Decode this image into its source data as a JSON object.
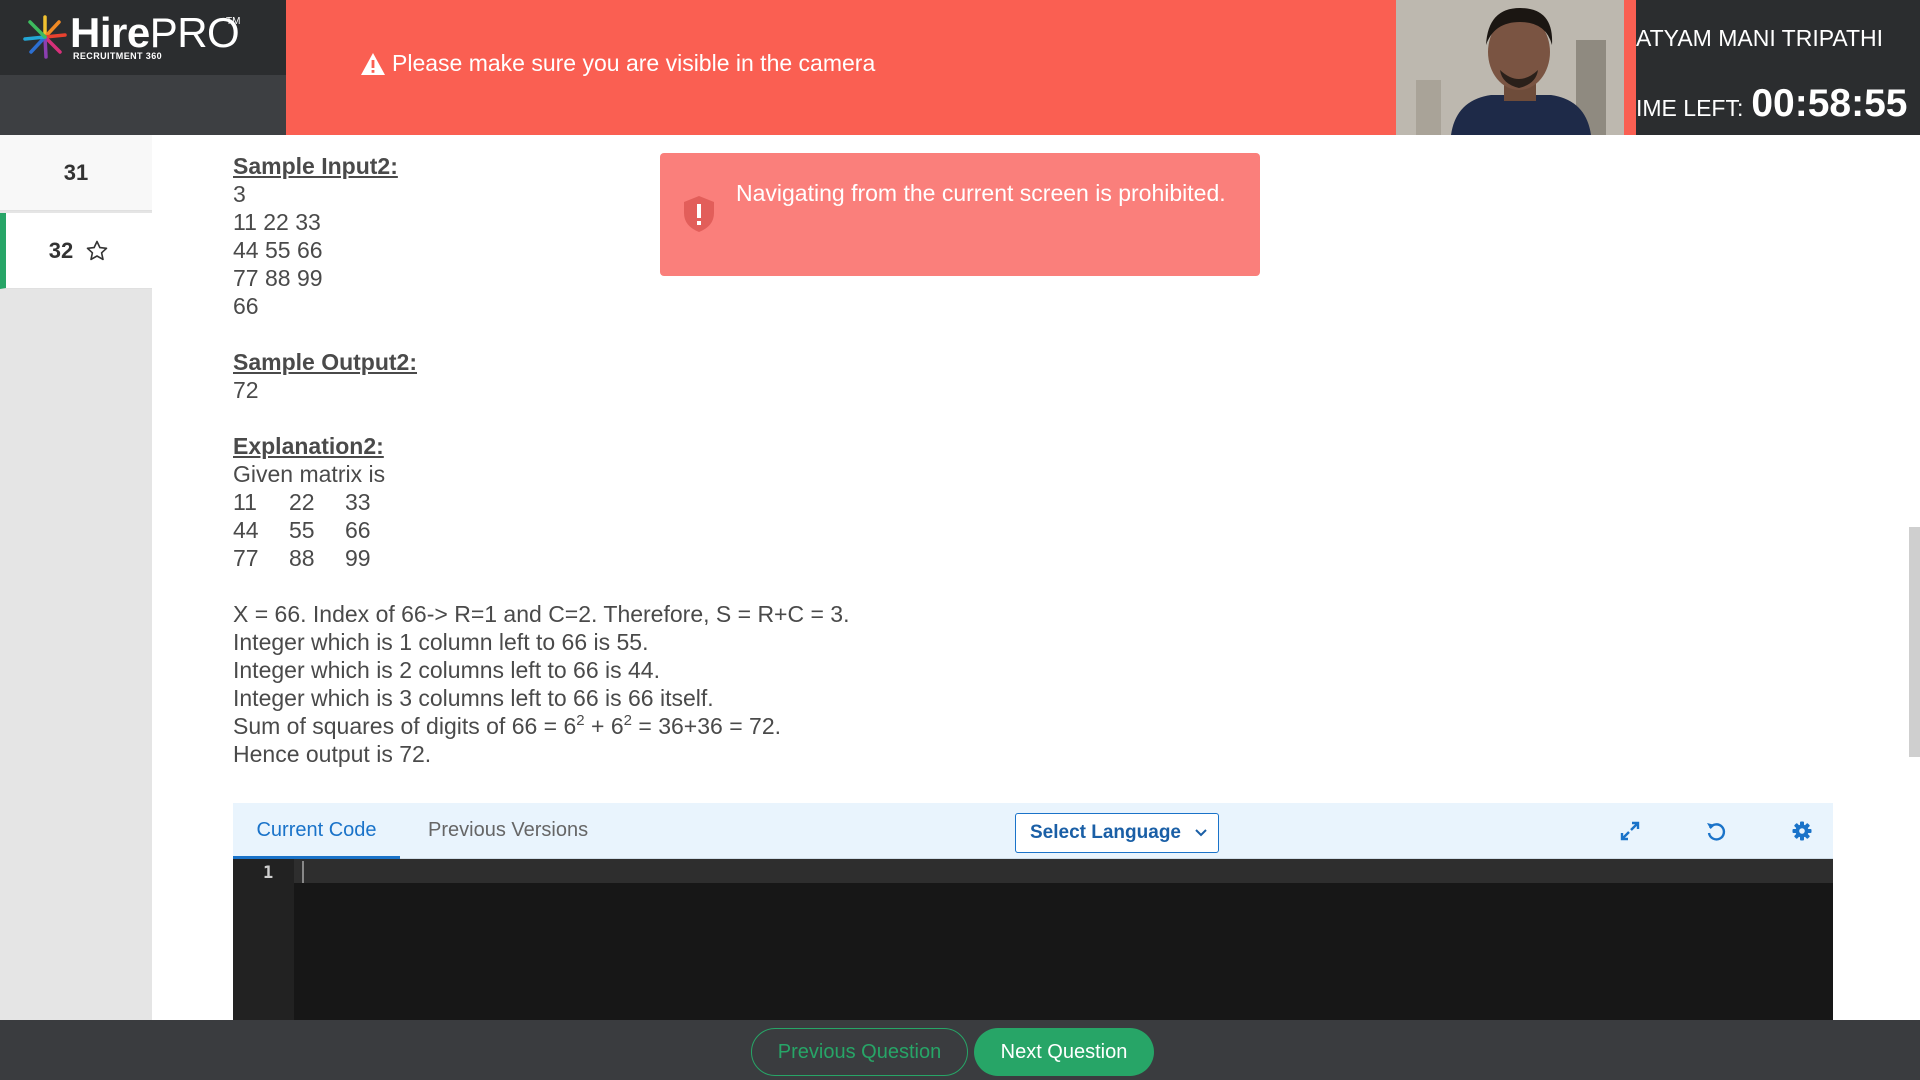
{
  "brand": {
    "name_bold": "Hire",
    "name_light": "PRO",
    "trademark": "TM",
    "tagline": "RECRUITMENT 360"
  },
  "alert": {
    "message": "Please make sure you are visible in the camera",
    "icon": "warning-triangle-icon",
    "color": "#fa5f52"
  },
  "user": {
    "name": "ATYAM MANI TRIPATHI",
    "time_label": "IME LEFT:",
    "time_value": "00:58:55"
  },
  "sidebar": {
    "items": [
      {
        "number": "31",
        "active": false
      },
      {
        "number": "32",
        "active": true,
        "icon": "star-outline-icon"
      }
    ],
    "active_color": "#27a567"
  },
  "question": {
    "sample_input_heading": "Sample Input2:",
    "sample_input_lines": [
      "3",
      "11 22 33",
      "44 55 66",
      "77 88 99",
      "66"
    ],
    "sample_output_heading": "Sample Output2:",
    "sample_output": "72",
    "explanation_heading": "Explanation2:",
    "explanation_intro": "Given matrix is",
    "matrix": [
      [
        "11",
        "22",
        "33"
      ],
      [
        "44",
        "55",
        "66"
      ],
      [
        "77",
        "88",
        "99"
      ]
    ],
    "explanation_lines": [
      "X = 66. Index of 66-> R=1 and C=2. Therefore, S = R+C = 3.",
      "Integer which is 1 column left to 66 is 55.",
      "Integer which is 2 columns left to 66 is 44.",
      "Integer which is 3 columns left to 66 is 66 itself."
    ],
    "sum_line": {
      "prefix": "Sum of squares of digits of 66 = 6",
      "exp1": "2",
      "middle": " + 6",
      "exp2": "2",
      "suffix": " = 36+36 = 72."
    },
    "conclusion": "Hence output is 72."
  },
  "toast": {
    "message": "Navigating from the current screen is prohibited.",
    "icon": "shield-alert-icon"
  },
  "editor": {
    "tabs": [
      "Current Code",
      "Previous Versions"
    ],
    "language_label": "Select Language",
    "line_number": "1",
    "tools": [
      "expand-icon",
      "reset-icon",
      "settings-gear-icon"
    ],
    "accent": "#1a73c9"
  },
  "footer": {
    "previous_label": "Previous Question",
    "next_label": "Next Question",
    "accent": "#27a567"
  }
}
